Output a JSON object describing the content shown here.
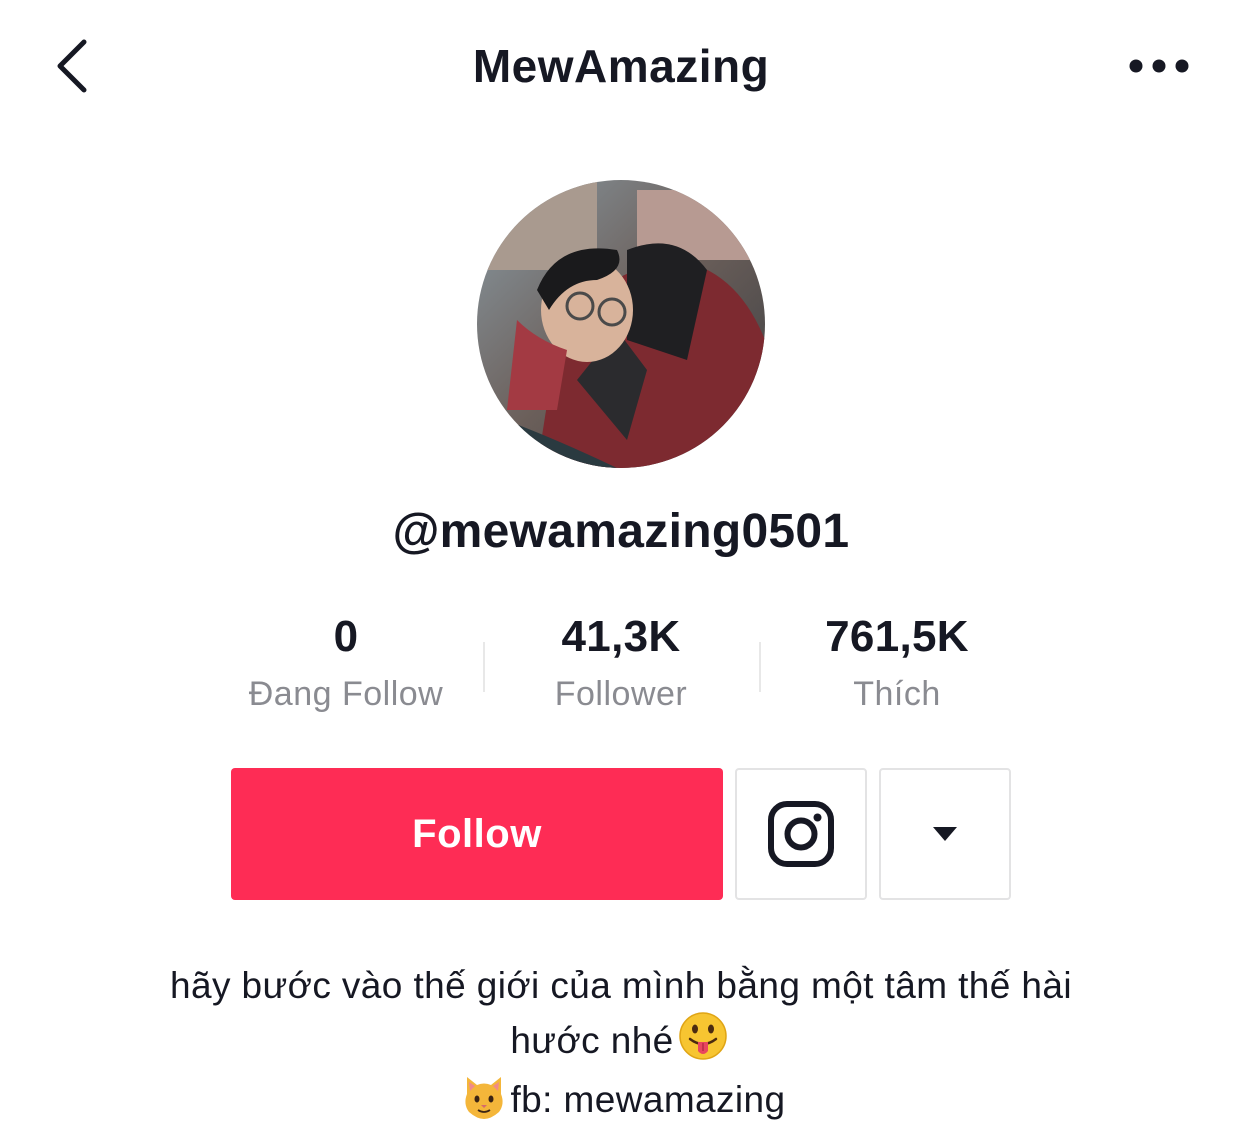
{
  "header": {
    "back_icon": "chevron-left-icon",
    "title": "MewAmazing",
    "more_icon": "more-horizontal-icon"
  },
  "profile": {
    "avatar_alt": "profile-photo",
    "handle": "@mewamazing0501"
  },
  "stats": [
    {
      "value": "0",
      "label": "Đang Follow"
    },
    {
      "value": "41,3K",
      "label": "Follower"
    },
    {
      "value": "761,5K",
      "label": "Thích"
    }
  ],
  "actions": {
    "follow_label": "Follow",
    "instagram_icon": "instagram-icon",
    "dropdown_icon": "caret-down-icon"
  },
  "bio": {
    "line1": "hãy bước vào thế giới của mình bằng một tâm thế hài",
    "line2": "hước nhé",
    "line2_emoji": "tongue-out-emoji",
    "line3_emoji": "cat-emoji",
    "line3": "fb: mewamazing"
  },
  "colors": {
    "accent": "#fe2c55",
    "text": "#161823",
    "muted": "#8a8b91",
    "border": "#e3e3e4"
  }
}
